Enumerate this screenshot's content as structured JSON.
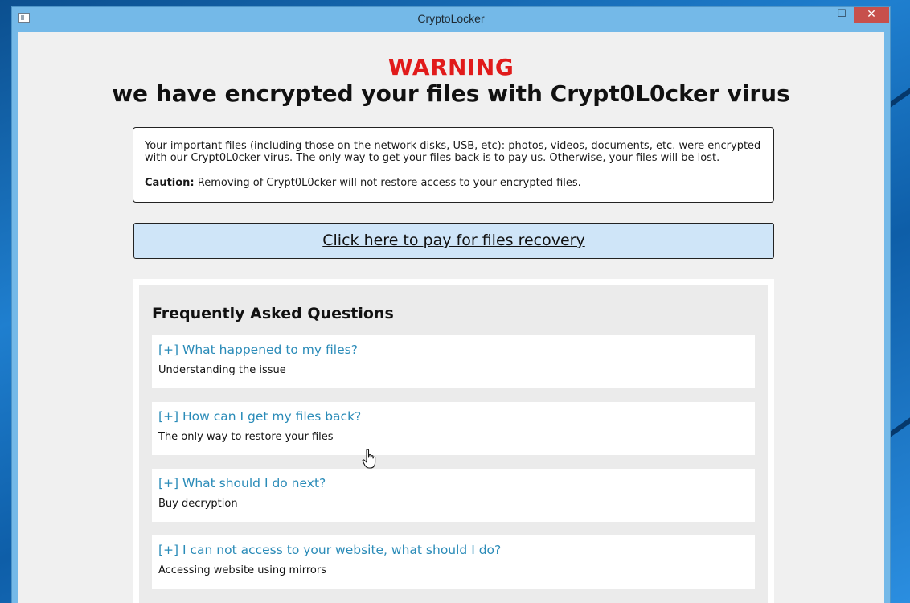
{
  "window": {
    "title": "CryptoLocker",
    "minimize_glyph": "–",
    "maximize_glyph": "☐",
    "close_glyph": "✕"
  },
  "header": {
    "warning": "WARNING",
    "headline": "we have encrypted your files with Crypt0L0cker virus"
  },
  "notice": {
    "paragraph": "Your important files (including those on the network disks, USB, etc): photos, videos, documents, etc. were encrypted with our Crypt0L0cker virus. The only way to get your files back is to pay us. Otherwise, your files will be lost.",
    "caution_label": "Caution:",
    "caution_text": " Removing of Crypt0L0cker will not restore access to your encrypted files."
  },
  "pay_button": {
    "label": "Click here to pay for files recovery"
  },
  "faq": {
    "title": "Frequently Asked Questions",
    "items": [
      {
        "question": "[+] What happened to my files?",
        "answer": "Understanding the issue"
      },
      {
        "question": "[+] How can I get my files back?",
        "answer": "The only way to restore your files"
      },
      {
        "question": "[+] What should I do next?",
        "answer": "Buy decryption"
      },
      {
        "question": "[+] I can not access to your website, what should I do?",
        "answer": "Accessing website using mirrors"
      }
    ]
  },
  "colors": {
    "warning": "#e11b1b",
    "link": "#2a8bb8",
    "pay_button_bg": "#cfe5f8",
    "titlebar": "#74b9e8",
    "close_button": "#c7504c"
  }
}
